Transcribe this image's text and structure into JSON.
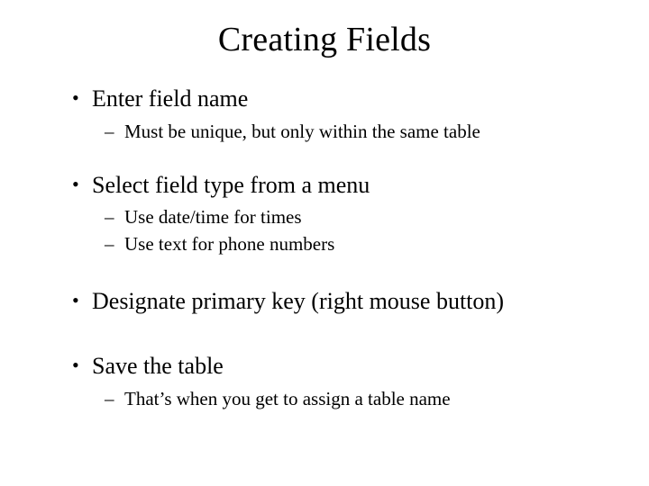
{
  "title": "Creating Fields",
  "bullets": [
    {
      "text": "Enter field name",
      "subs": [
        "Must be unique, but only within the same table"
      ]
    },
    {
      "text": "Select field type from a menu",
      "subs": [
        "Use date/time for times",
        "Use text for phone numbers"
      ]
    },
    {
      "text": "Designate primary key (right mouse button)",
      "subs": []
    },
    {
      "text": "Save the table",
      "subs": [
        "That’s when you get to assign a table name"
      ]
    }
  ]
}
